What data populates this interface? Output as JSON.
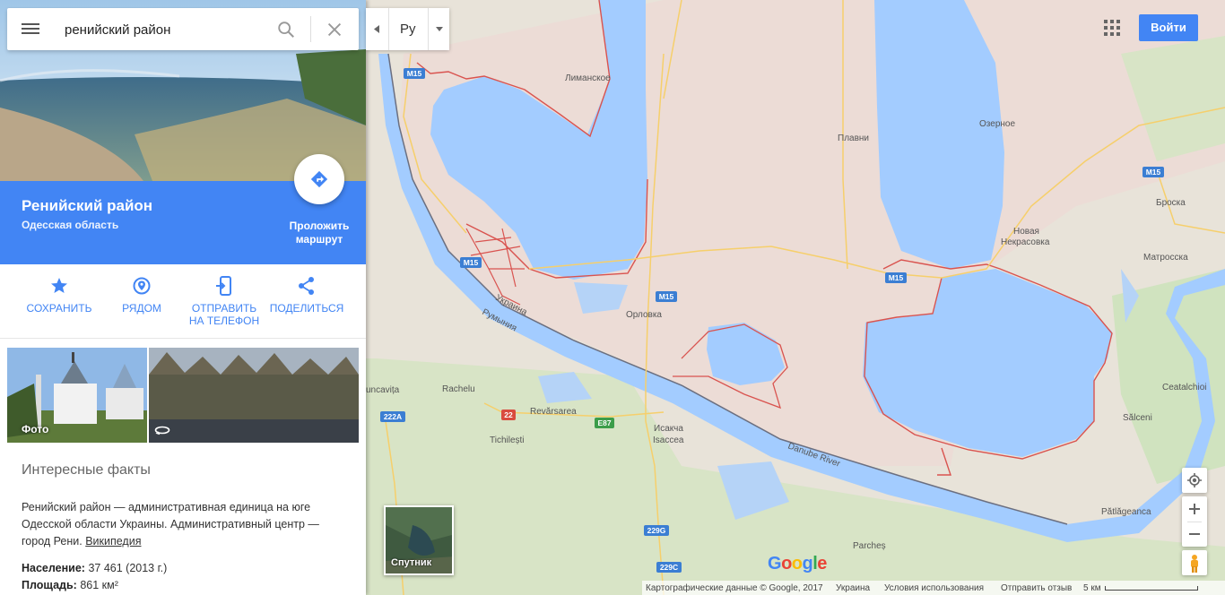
{
  "search": {
    "value": "ренийский район"
  },
  "place": {
    "title": "Ренийский район",
    "subtitle": "Одесская область",
    "route_label": "Проложить маршрут"
  },
  "actions": [
    {
      "label": "СОХРАНИТЬ",
      "icon": "star-icon"
    },
    {
      "label": "РЯДОМ",
      "icon": "nearby-pin-icon"
    },
    {
      "label": "ОТПРАВИТЬ НА ТЕЛЕФОН",
      "icon": "send-to-phone-icon"
    },
    {
      "label": "ПОДЕЛИТЬСЯ",
      "icon": "share-icon"
    }
  ],
  "photos": {
    "label": "Фото"
  },
  "facts": {
    "title": "Интересные факты",
    "text": "Ренийский район — административная единица на юге Одесской области Украины. Административный центр — город Рени.",
    "link": "Википедия",
    "population_label": "Население:",
    "population_value": "37 461 (2013 г.)",
    "area_label": "Площадь:",
    "area_value": "861 км²"
  },
  "lang": {
    "label": "Ру"
  },
  "header": {
    "login": "Войти"
  },
  "satellite": {
    "label": "Спутник"
  },
  "google_logo": {
    "letters": [
      "G",
      "o",
      "o",
      "g",
      "l",
      "e"
    ],
    "colors": [
      "#4285f4",
      "#ea4335",
      "#fbbc05",
      "#4285f4",
      "#34a853",
      "#ea4335"
    ]
  },
  "map_labels": {
    "limanskoe": "Лиманское",
    "plavni": "Плавни",
    "ozernoe": "Озерное",
    "broska": "Броска",
    "novaya_nekrasovka_1": "Новая",
    "novaya_nekrasovka_2": "Некрасовка",
    "matrosska": "Матросска",
    "orlovka": "Орловка",
    "ukraina": "Украина",
    "rumyniya": "Румыния",
    "uncavita": "uncavița",
    "rachelu": "Rachelu",
    "revarsarea": "Revărsarea",
    "isakcha": "Исакча",
    "isaccea": "Isaccea",
    "tichilesti": "Tichilești",
    "danube": "Danube River",
    "ceatalchioi": "Ceatalchioi",
    "salceni": "Sălceni",
    "patlageanca": "Pătlăgeanca",
    "parches": "Parcheș"
  },
  "road_shields": {
    "m15": "M15",
    "r222a": "222A",
    "r22": "22",
    "e87": "E87",
    "r229g": "229G",
    "r229c": "229C"
  },
  "footer": {
    "copyright": "Картографические данные © Google, 2017",
    "country": "Украина",
    "terms": "Условия использования",
    "feedback": "Отправить отзыв",
    "scale": "5 км"
  },
  "colors": {
    "accent": "#4285f4",
    "water": "#a3ccff",
    "land": "#e8e3d9",
    "boundary": "#d9534f",
    "green": "#c6dfb0"
  }
}
